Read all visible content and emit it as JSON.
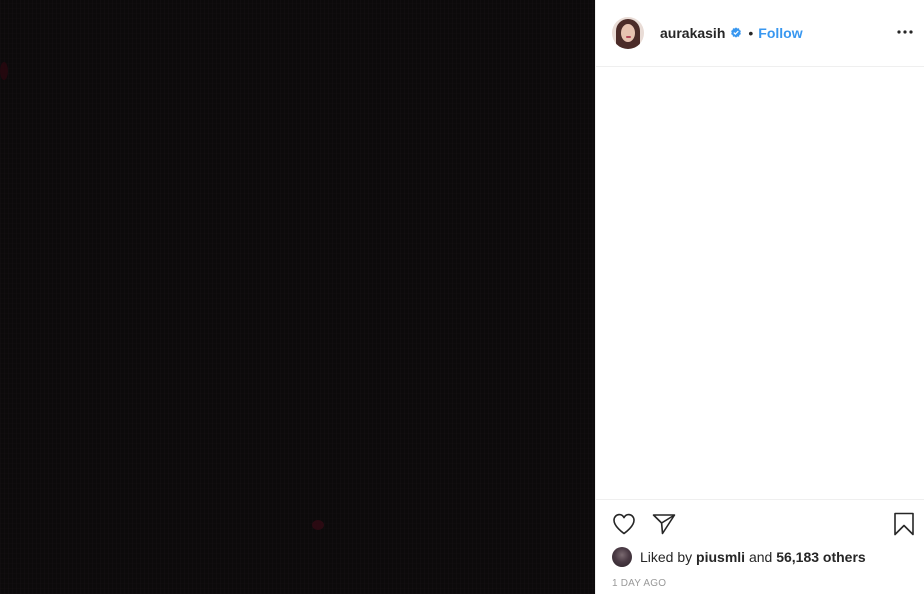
{
  "post": {
    "username": "aurakasih",
    "separator": "•",
    "follow_label": "Follow",
    "liked_prefix": "Liked by",
    "liked_user": "piusmli",
    "liked_and": "and",
    "liked_count": "56,183 others",
    "timestamp": "1 DAY AGO"
  },
  "icons": {
    "verified": "verified-badge-icon",
    "more": "more-options-icon",
    "like": "heart-icon",
    "share": "paper-plane-icon",
    "save": "bookmark-icon"
  },
  "colors": {
    "accent": "#3897f0",
    "verified": "#3897f0",
    "text": "#262626",
    "muted": "#999999",
    "media_bg": "#0c0a0b"
  }
}
